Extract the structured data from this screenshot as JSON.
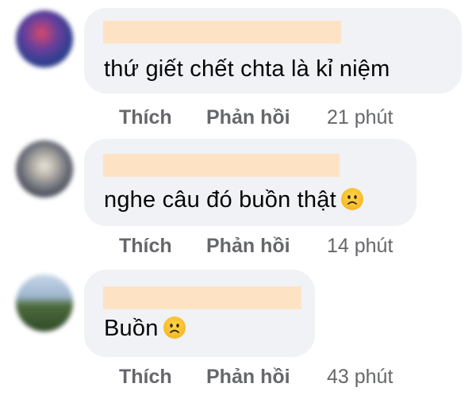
{
  "comments": [
    {
      "text": "thứ giết chết chta là kỉ niệm",
      "emoji": "",
      "like": "Thích",
      "reply": "Phản hồi",
      "time": "21 phút"
    },
    {
      "text": "nghe câu đó buồn thật",
      "emoji": "sad-face-icon",
      "like": "Thích",
      "reply": "Phản hồi",
      "time": "14 phút"
    },
    {
      "text": "Buồn",
      "emoji": "sad-face-icon",
      "like": "Thích",
      "reply": "Phản hồi",
      "time": "43 phút"
    }
  ],
  "colors": {
    "bubble": "#f0f2f5",
    "redaction": "#fde3c4",
    "action_text": "#65676b",
    "body_text": "#050505"
  }
}
